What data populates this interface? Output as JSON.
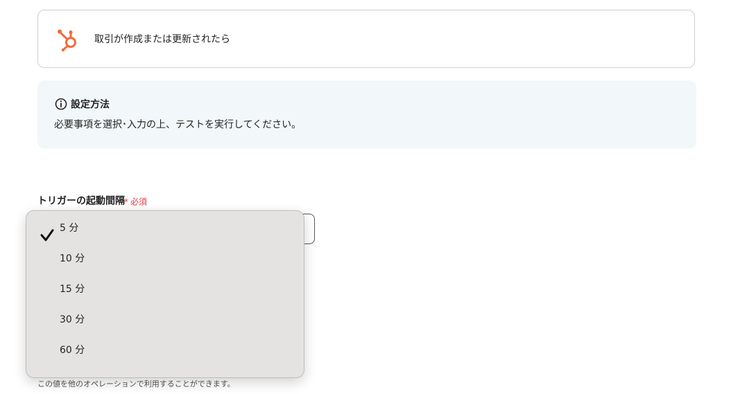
{
  "trigger": {
    "title": "取引が作成または更新されたら",
    "icon": "hubspot-logo-icon",
    "brand_color": "#f26b3a"
  },
  "info": {
    "icon": "info-icon",
    "title": "設定方法",
    "text": "必要事項を選択･入力の上、テストを実行してください。"
  },
  "field": {
    "label": "トリガーの起動間隔",
    "required_asterisk": "*",
    "required_label": "必須",
    "helper_text": "この値を他のオペレーションで利用することができます。"
  },
  "dropdown": {
    "selected": "5 分",
    "options": [
      {
        "label": "5 分",
        "checked": true
      },
      {
        "label": "10 分",
        "checked": false
      },
      {
        "label": "15 分",
        "checked": false
      },
      {
        "label": "30 分",
        "checked": false
      },
      {
        "label": "60 分",
        "checked": false
      }
    ]
  },
  "colors": {
    "required": "#e03a45",
    "info_bg": "#f2f8f9",
    "dropdown_bg": "#e4e3e1"
  }
}
